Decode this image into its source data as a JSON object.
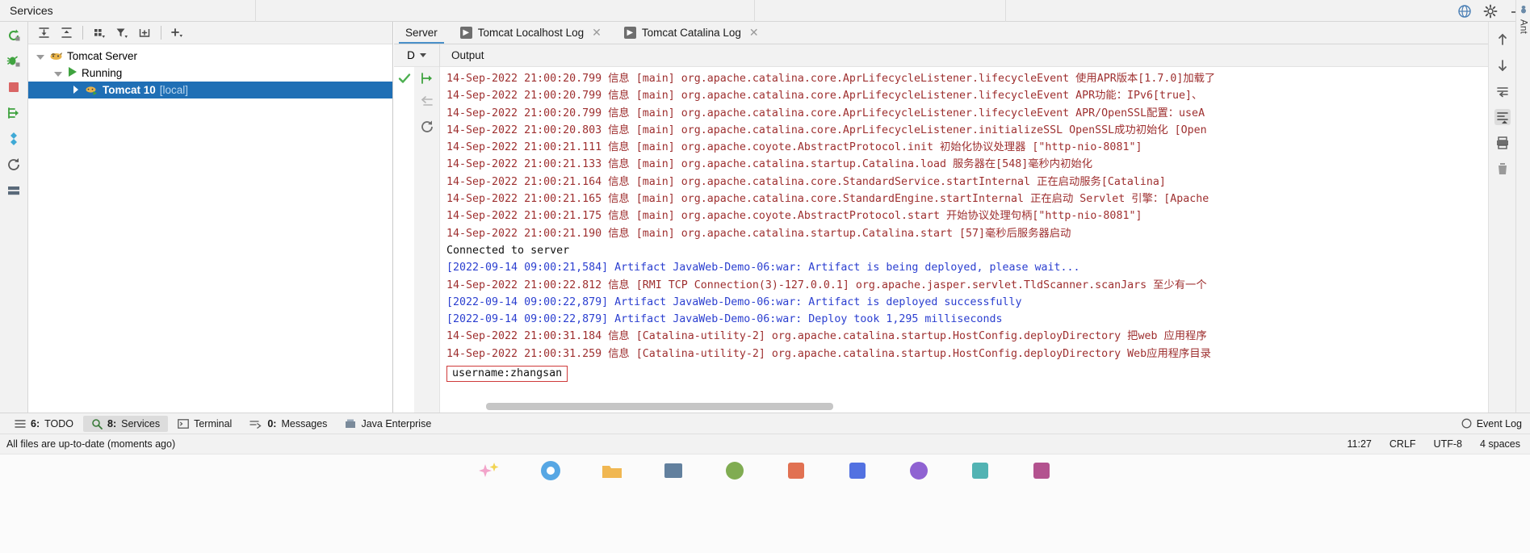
{
  "window": {
    "title": "Services",
    "top_icons": [
      "globe-icon",
      "gear-icon",
      "minimize-icon"
    ]
  },
  "left_rail": {
    "items": [
      {
        "name": "rerun-icon",
        "label": "Rerun"
      },
      {
        "name": "debug-icon",
        "label": "Debug"
      },
      {
        "name": "stop-icon",
        "label": "Stop"
      },
      {
        "name": "redeploy-icon",
        "label": "Redeploy"
      },
      {
        "name": "update-icon",
        "label": "Update"
      },
      {
        "name": "refresh-icon",
        "label": "Refresh"
      },
      {
        "name": "grid-icon",
        "label": "Show Servers"
      }
    ]
  },
  "tree_toolbar": {
    "buttons": [
      {
        "name": "expand-all-icon",
        "label": "Expand All"
      },
      {
        "name": "collapse-all-icon",
        "label": "Collapse All"
      },
      {
        "name": "group-by-icon",
        "label": "Group By"
      },
      {
        "name": "filter-icon",
        "label": "Filter"
      },
      {
        "name": "add-tab-icon",
        "label": "Add Tab"
      },
      {
        "name": "add-icon",
        "label": "Add Service"
      }
    ]
  },
  "tree": {
    "nodes": [
      {
        "label": "Tomcat Server",
        "icon": "tomcat-icon",
        "expanded": true,
        "level": 0,
        "selected": false
      },
      {
        "label": "Running",
        "icon": "run-icon",
        "expanded": true,
        "level": 1,
        "selected": false
      },
      {
        "label": "Tomcat 10",
        "suffix": "[local]",
        "icon": "tomcat-run-icon",
        "expanded": false,
        "level": 2,
        "selected": true
      }
    ]
  },
  "tabs": [
    {
      "label": "Server",
      "active": true,
      "has_icon": false,
      "closable": false
    },
    {
      "label": "Tomcat Localhost Log",
      "active": false,
      "has_icon": true,
      "closable": true
    },
    {
      "label": "Tomcat Catalina Log",
      "active": false,
      "has_icon": true,
      "closable": true
    }
  ],
  "sub_header": {
    "dropdown_label": "D",
    "output_label": "Output"
  },
  "console_gutter": {
    "status_icon": "green-check-icon",
    "buttons": [
      {
        "name": "scroll-to-end-icon",
        "enabled": true
      },
      {
        "name": "soft-wrap-icon",
        "enabled": false
      },
      {
        "name": "rerun-icon",
        "enabled": true
      }
    ]
  },
  "console": {
    "lines": [
      {
        "color": "red",
        "text": "14-Sep-2022 21:00:20.799 信息 [main] org.apache.catalina.core.AprLifecycleListener.lifecycleEvent 使用APR版本[1.7.0]加载了"
      },
      {
        "color": "red",
        "text": "14-Sep-2022 21:00:20.799 信息 [main] org.apache.catalina.core.AprLifecycleListener.lifecycleEvent APR功能：IPv6[true]、"
      },
      {
        "color": "red",
        "text": "14-Sep-2022 21:00:20.799 信息 [main] org.apache.catalina.core.AprLifecycleListener.lifecycleEvent APR/OpenSSL配置：useA"
      },
      {
        "color": "red",
        "text": "14-Sep-2022 21:00:20.803 信息 [main] org.apache.catalina.core.AprLifecycleListener.initializeSSL OpenSSL成功初始化 [Open"
      },
      {
        "color": "red",
        "text": "14-Sep-2022 21:00:21.111 信息 [main] org.apache.coyote.AbstractProtocol.init 初始化协议处理器 [\"http-nio-8081\"]"
      },
      {
        "color": "red",
        "text": "14-Sep-2022 21:00:21.133 信息 [main] org.apache.catalina.startup.Catalina.load 服务器在[548]毫秒内初始化"
      },
      {
        "color": "red",
        "text": "14-Sep-2022 21:00:21.164 信息 [main] org.apache.catalina.core.StandardService.startInternal 正在启动服务[Catalina]"
      },
      {
        "color": "red",
        "text": "14-Sep-2022 21:00:21.165 信息 [main] org.apache.catalina.core.StandardEngine.startInternal 正在启动 Servlet 引擎：[Apache"
      },
      {
        "color": "red",
        "text": "14-Sep-2022 21:00:21.175 信息 [main] org.apache.coyote.AbstractProtocol.start 开始协议处理句柄[\"http-nio-8081\"]"
      },
      {
        "color": "red",
        "text": "14-Sep-2022 21:00:21.190 信息 [main] org.apache.catalina.startup.Catalina.start [57]毫秒后服务器启动"
      },
      {
        "color": "black",
        "text": "Connected to server"
      },
      {
        "color": "blue",
        "text": "[2022-09-14 09:00:21,584] Artifact JavaWeb-Demo-06:war: Artifact is being deployed, please wait..."
      },
      {
        "color": "red",
        "text": "14-Sep-2022 21:00:22.812 信息 [RMI TCP Connection(3)-127.0.0.1] org.apache.jasper.servlet.TldScanner.scanJars 至少有一个"
      },
      {
        "color": "blue",
        "text": "[2022-09-14 09:00:22,879] Artifact JavaWeb-Demo-06:war: Artifact is deployed successfully"
      },
      {
        "color": "blue",
        "text": "[2022-09-14 09:00:22,879] Artifact JavaWeb-Demo-06:war: Deploy took 1,295 milliseconds"
      },
      {
        "color": "red",
        "text": "14-Sep-2022 21:00:31.184 信息 [Catalina-utility-2] org.apache.catalina.startup.HostConfig.deployDirectory 把web 应用程序"
      },
      {
        "color": "red",
        "text": "14-Sep-2022 21:00:31.259 信息 [Catalina-utility-2] org.apache.catalina.startup.HostConfig.deployDirectory Web应用程序目录"
      }
    ],
    "highlight": {
      "text": "username:zhangsan",
      "border_color": "#cf3a3a"
    }
  },
  "right_rail": {
    "items": [
      {
        "name": "up-arrow-icon",
        "label": "Previous"
      },
      {
        "name": "down-arrow-icon",
        "label": "Next"
      },
      {
        "name": "soft-wrap-icon",
        "label": "Soft-Wrap"
      },
      {
        "name": "scroll-to-end-icon",
        "label": "Scroll to End",
        "active": true
      },
      {
        "name": "print-icon",
        "label": "Print"
      },
      {
        "name": "trash-icon",
        "label": "Clear All"
      }
    ]
  },
  "ant_strip": {
    "label": "Ant",
    "icon": "ant-icon"
  },
  "bottom_bar": {
    "items": [
      {
        "num": "6:",
        "label": "TODO",
        "icon": "todo-icon",
        "active": false
      },
      {
        "num": "8:",
        "label": "Services",
        "icon": "services-icon",
        "active": true
      },
      {
        "num": "",
        "label": "Terminal",
        "icon": "terminal-icon",
        "active": false
      },
      {
        "num": "0:",
        "label": "Messages",
        "icon": "messages-icon",
        "active": false
      },
      {
        "num": "",
        "label": "Java Enterprise",
        "icon": "java-enterprise-icon",
        "active": false
      }
    ],
    "event_log": {
      "label": "Event Log",
      "icon": "event-log-icon"
    }
  },
  "status_bar": {
    "message": "All files are up-to-date (moments ago)",
    "time": "11:27",
    "line_sep": "CRLF",
    "encoding": "UTF-8",
    "indent": "4 spaces"
  },
  "colors": {
    "selection_blue": "#1f6fb5",
    "log_red": "#9e2f2f",
    "log_blue": "#2b3fd0",
    "accent_underline": "#4a90c9",
    "panel_bg": "#f2f2f2"
  }
}
